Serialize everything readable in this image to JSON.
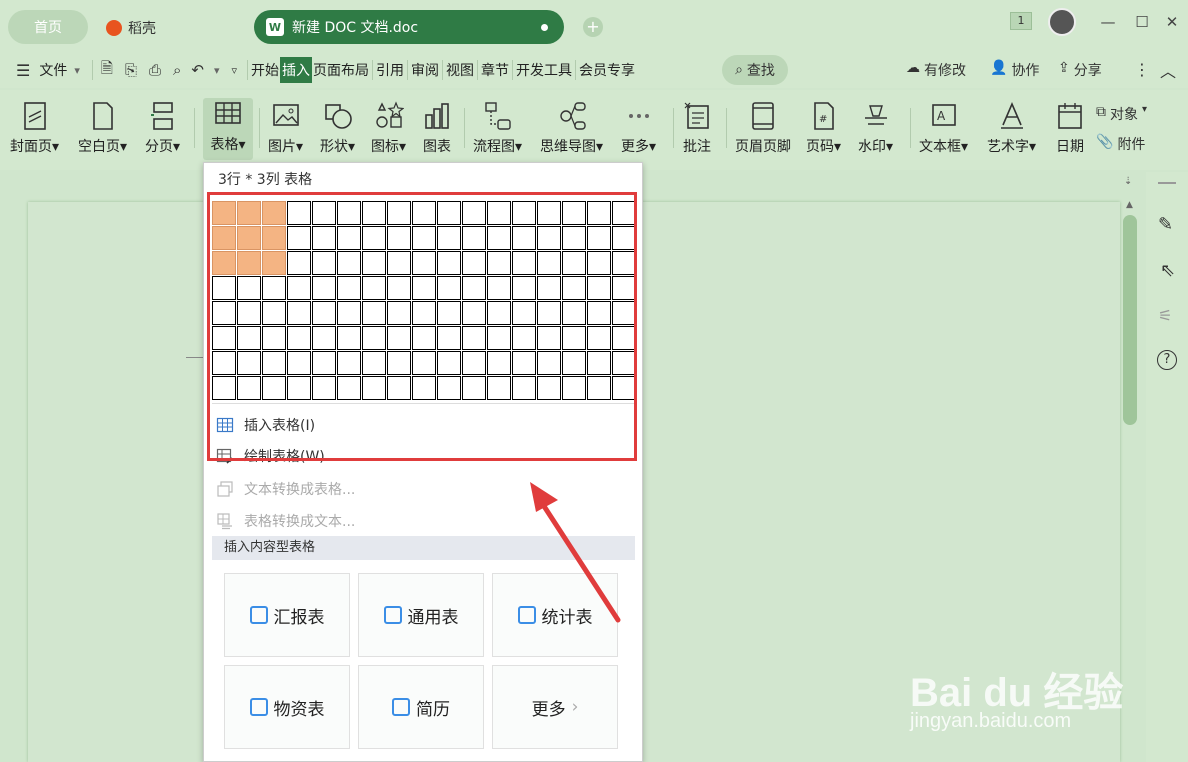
{
  "tabs": {
    "home": "首页",
    "daoke": "稻壳",
    "doc": "新建 DOC 文档.doc",
    "add": "+"
  },
  "window": {
    "badge": "1"
  },
  "menubar": {
    "file": "文件",
    "items": [
      "开始",
      "插入",
      "页面布局",
      "引用",
      "审阅",
      "视图",
      "章节",
      "开发工具",
      "会员专享"
    ],
    "search": "查找",
    "right": {
      "modify": "有修改",
      "collab": "协作",
      "share": "分享"
    }
  },
  "ribbon": {
    "cover": "封面页",
    "blank": "空白页",
    "pagebreak": "分页",
    "table": "表格",
    "picture": "图片",
    "shape": "形状",
    "icon": "图标",
    "chart": "图表",
    "flowchart": "流程图",
    "mindmap": "思维导图",
    "more": "更多",
    "comment": "批注",
    "headerfooter": "页眉页脚",
    "pagenum": "页码",
    "watermark": "水印",
    "textbox": "文本框",
    "wordart": "艺术字",
    "date": "日期",
    "object": "对象",
    "attachment": "附件"
  },
  "dropdown": {
    "title": "3行 * 3列 表格",
    "grid": {
      "rows": 8,
      "cols": 17,
      "selected_rows": 3,
      "selected_cols": 3
    },
    "insert_table": "插入表格(I)",
    "draw_table": "绘制表格(W)",
    "text_to_table": "文本转换成表格...",
    "table_to_text": "表格转换成文本...",
    "section": "插入内容型表格",
    "cards": [
      "汇报表",
      "通用表",
      "统计表",
      "物资表",
      "简历",
      "更多"
    ]
  },
  "watermark": {
    "brand": "Bai du 经验",
    "url": "jingyan.baidu.com"
  },
  "colors": {
    "accent": "#2f7b45",
    "bg": "#d3e8cf",
    "highlight": "#f4b483",
    "redbox": "#e03c3c"
  }
}
